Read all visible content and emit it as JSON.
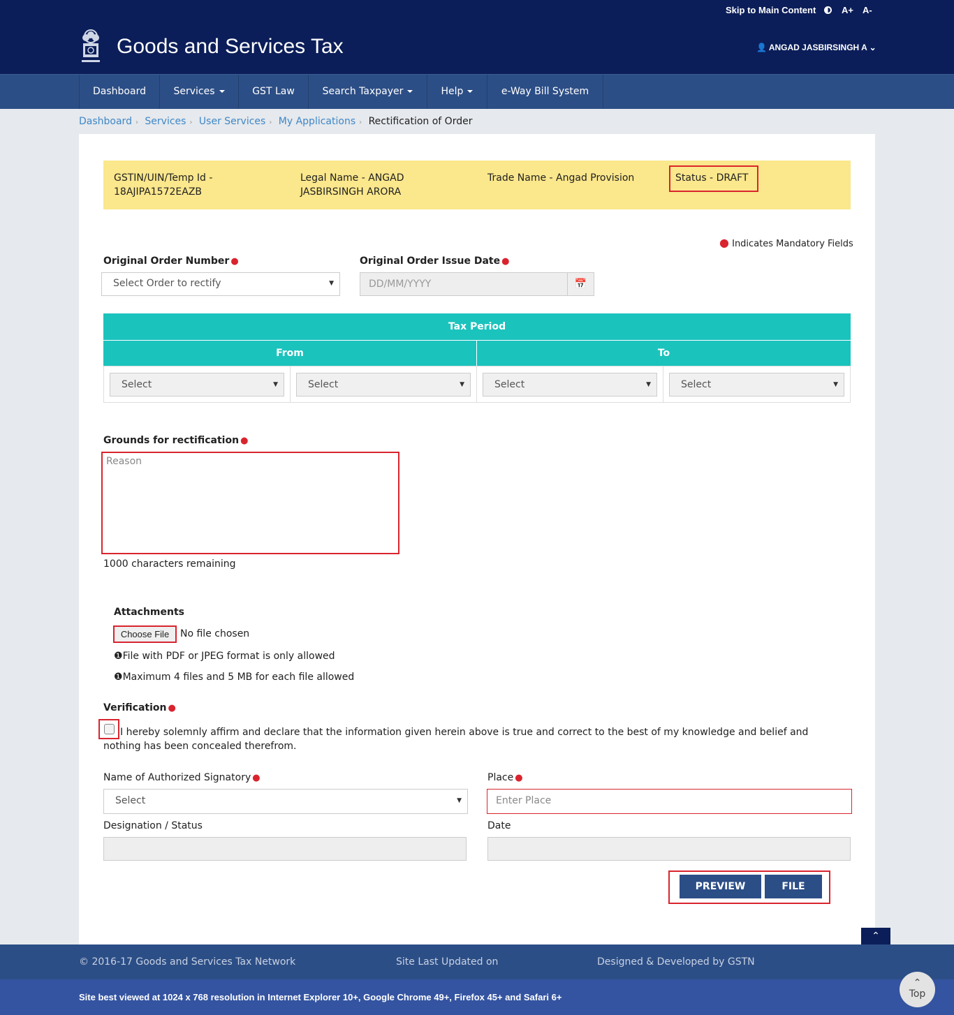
{
  "topbar": {
    "skip": "Skip to Main Content",
    "contrast_icon": "contrast-icon",
    "font_up": "A+",
    "font_down": "A-"
  },
  "header": {
    "title": "Goods and Services Tax",
    "user": "ANGAD JASBIRSINGH A",
    "emblem_icon": "national-emblem-icon"
  },
  "nav": {
    "items": [
      {
        "label": "Dashboard",
        "dropdown": false
      },
      {
        "label": "Services",
        "dropdown": true
      },
      {
        "label": "GST Law",
        "dropdown": false
      },
      {
        "label": "Search Taxpayer",
        "dropdown": true
      },
      {
        "label": "Help",
        "dropdown": true
      },
      {
        "label": "e-Way Bill System",
        "dropdown": false
      }
    ]
  },
  "breadcrumb": [
    "Dashboard",
    "Services",
    "User Services",
    "My Applications",
    "Rectification of Order"
  ],
  "info": {
    "gstin_label": "GSTIN/UIN/Temp Id -",
    "gstin_value": "18AJIPA1572EAZB",
    "legal_label": "Legal Name - ANGAD",
    "legal_value": "JASBIRSINGH ARORA",
    "trade": "Trade Name - Angad Provision",
    "status": "Status - DRAFT"
  },
  "mandatory_note": "Indicates Mandatory Fields",
  "order": {
    "number_label": "Original Order Number",
    "number_value": "Select Order to rectify",
    "date_label": "Original Order Issue Date",
    "date_placeholder": "DD/MM/YYYY"
  },
  "tax_period": {
    "title": "Tax Period",
    "from": "From",
    "to": "To",
    "selects": [
      "Select",
      "Select",
      "Select",
      "Select"
    ]
  },
  "grounds": {
    "label": "Grounds for rectification",
    "placeholder": "Reason",
    "remaining": "1000 characters remaining"
  },
  "attachments": {
    "label": "Attachments",
    "choose": "Choose File",
    "no_file": "No file chosen",
    "note1": "File with PDF or JPEG format is only allowed",
    "note2": "Maximum 4 files and 5 MB for each file allowed"
  },
  "verification": {
    "label": "Verification",
    "text1": "I hereby solemnly affirm and declare that the information given herein above is true and correct to the best of my knowledge and belief and",
    "text2": "nothing has been concealed therefrom."
  },
  "signatory": {
    "name_label": "Name of Authorized Signatory",
    "name_value": "Select",
    "place_label": "Place",
    "place_placeholder": "Enter Place",
    "designation_label": "Designation / Status",
    "date_label": "Date"
  },
  "buttons": {
    "preview": "PREVIEW",
    "file": "FILE",
    "top": "Top"
  },
  "footer": {
    "copyright": "© 2016-17 Goods and Services Tax Network",
    "updated": "Site Last Updated on",
    "designed": "Designed & Developed by GSTN",
    "best_viewed": "Site best viewed at 1024 x 768 resolution in Internet Explorer 10+, Google Chrome 49+, Firefox 45+ and Safari 6+"
  },
  "colors": {
    "navy": "#0b1e59",
    "nav": "#2c4e86",
    "teal": "#1bc3bd",
    "highlight": "#d9242e",
    "info_bg": "#fbe78c"
  }
}
